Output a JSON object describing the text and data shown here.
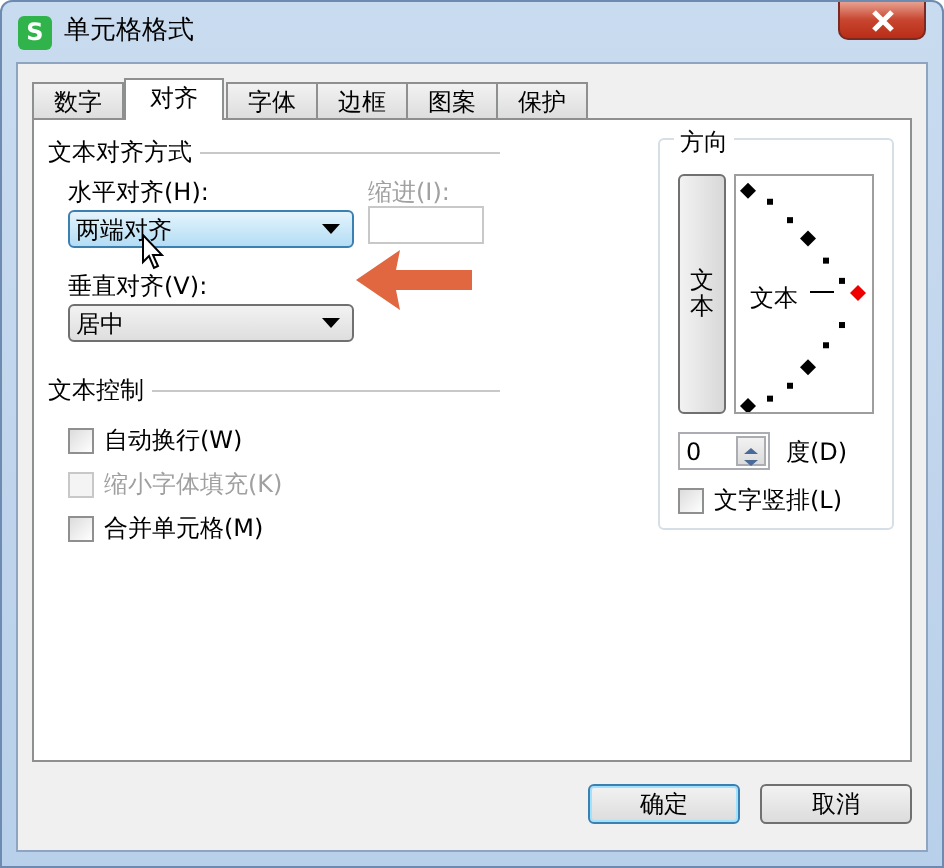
{
  "window": {
    "title": "单元格格式",
    "icon_letter": "S"
  },
  "tabs": [
    {
      "label": "数字",
      "selected": false
    },
    {
      "label": "对齐",
      "selected": true
    },
    {
      "label": "字体",
      "selected": false
    },
    {
      "label": "边框",
      "selected": false
    },
    {
      "label": "图案",
      "selected": false
    },
    {
      "label": "保护",
      "selected": false
    }
  ],
  "alignment": {
    "title": "文本对齐方式",
    "horizontal": {
      "label": "水平对齐(H):",
      "value": "两端对齐",
      "focused": true
    },
    "indent": {
      "label": "缩进(I):",
      "disabled": true
    },
    "vertical": {
      "label": "垂直对齐(V):",
      "value": "居中",
      "focused": false
    }
  },
  "text_control": {
    "title": "文本控制",
    "options": [
      {
        "label": "自动换行(W)",
        "checked": false,
        "disabled": false
      },
      {
        "label": "缩小字体填充(K)",
        "checked": false,
        "disabled": true
      },
      {
        "label": "合并单元格(M)",
        "checked": false,
        "disabled": false
      }
    ]
  },
  "orientation": {
    "title": "方向",
    "vertical_button": "文本",
    "dial_text": "文本",
    "degrees": "0",
    "degrees_label": "度(D)",
    "stacked": {
      "label": "文字竖排(L)",
      "checked": false
    }
  },
  "buttons": [
    {
      "label": "确定",
      "default": true
    },
    {
      "label": "取消",
      "default": false
    }
  ]
}
